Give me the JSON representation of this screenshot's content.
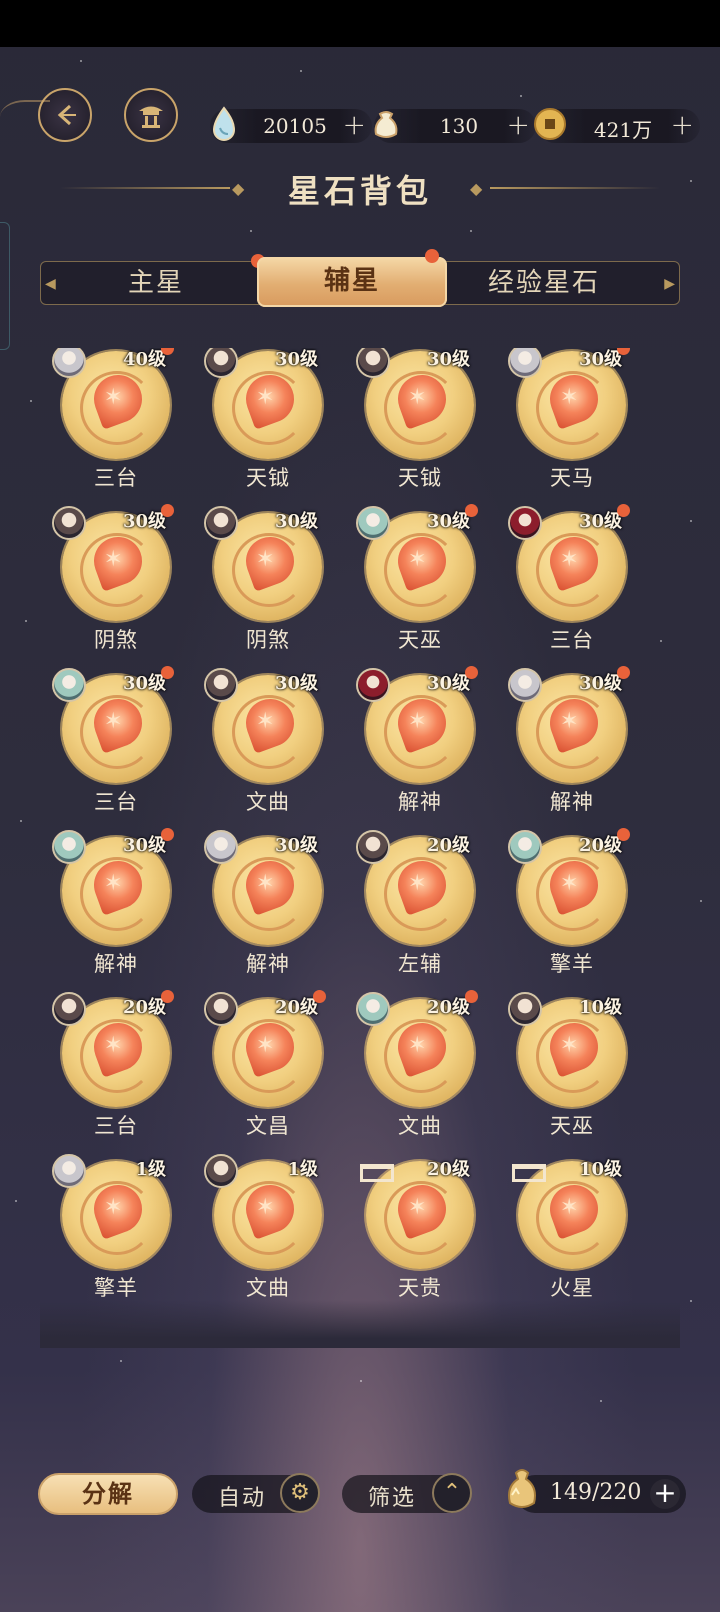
{
  "header": {
    "title": "星石背包",
    "currencies": [
      {
        "icon": "water-drop-icon",
        "value": "20105"
      },
      {
        "icon": "pouch-icon",
        "value": "130"
      },
      {
        "icon": "coin-icon",
        "value": "421万"
      }
    ]
  },
  "tabs": [
    {
      "label": "主星",
      "badge": true,
      "active": false
    },
    {
      "label": "辅星",
      "badge": true,
      "active": true
    },
    {
      "label": "经验星石",
      "badge": false,
      "active": false
    }
  ],
  "items": [
    {
      "name": "三台",
      "level": "40级",
      "avatar": "light",
      "badge": true,
      "locked": false
    },
    {
      "name": "天钺",
      "level": "30级",
      "avatar": "dark",
      "badge": false,
      "locked": false
    },
    {
      "name": "天钺",
      "level": "30级",
      "avatar": "dark",
      "badge": false,
      "locked": false
    },
    {
      "name": "天马",
      "level": "30级",
      "avatar": "light",
      "badge": true,
      "locked": false
    },
    {
      "name": "阴煞",
      "level": "30级",
      "avatar": "dark",
      "badge": true,
      "locked": false
    },
    {
      "name": "阴煞",
      "level": "30级",
      "avatar": "dark",
      "badge": false,
      "locked": false
    },
    {
      "name": "天巫",
      "level": "30级",
      "avatar": "teal",
      "badge": true,
      "locked": false
    },
    {
      "name": "三台",
      "level": "30级",
      "avatar": "red",
      "badge": true,
      "locked": false
    },
    {
      "name": "三台",
      "level": "30级",
      "avatar": "teal",
      "badge": true,
      "locked": false
    },
    {
      "name": "文曲",
      "level": "30级",
      "avatar": "dark",
      "badge": false,
      "locked": false
    },
    {
      "name": "解神",
      "level": "30级",
      "avatar": "red",
      "badge": true,
      "locked": false
    },
    {
      "name": "解神",
      "level": "30级",
      "avatar": "light",
      "badge": true,
      "locked": false
    },
    {
      "name": "解神",
      "level": "30级",
      "avatar": "teal",
      "badge": true,
      "locked": false
    },
    {
      "name": "解神",
      "level": "30级",
      "avatar": "light",
      "badge": false,
      "locked": false
    },
    {
      "name": "左辅",
      "level": "20级",
      "avatar": "dark",
      "badge": false,
      "locked": false
    },
    {
      "name": "擎羊",
      "level": "20级",
      "avatar": "teal",
      "badge": true,
      "locked": false
    },
    {
      "name": "三台",
      "level": "20级",
      "avatar": "dark",
      "badge": true,
      "locked": false
    },
    {
      "name": "文昌",
      "level": "20级",
      "avatar": "dark",
      "badge": true,
      "locked": false
    },
    {
      "name": "文曲",
      "level": "20级",
      "avatar": "teal",
      "badge": true,
      "locked": false
    },
    {
      "name": "天巫",
      "level": "10级",
      "avatar": "dark",
      "badge": false,
      "locked": false
    },
    {
      "name": "擎羊",
      "level": "1级",
      "avatar": "light",
      "badge": false,
      "locked": false
    },
    {
      "name": "文曲",
      "level": "1级",
      "avatar": "dark",
      "badge": false,
      "locked": false
    },
    {
      "name": "天贵",
      "level": "20级",
      "avatar": "",
      "badge": false,
      "locked": true
    },
    {
      "name": "火星",
      "level": "10级",
      "avatar": "",
      "badge": false,
      "locked": true
    }
  ],
  "bottom": {
    "decompose_label": "分解",
    "auto_label": "自动",
    "filter_label": "筛选",
    "capacity": "149/220"
  },
  "colors": {
    "accent_gold": "#c9a46a",
    "badge_red": "#e8623a",
    "tab_active": "#e2ae72"
  }
}
